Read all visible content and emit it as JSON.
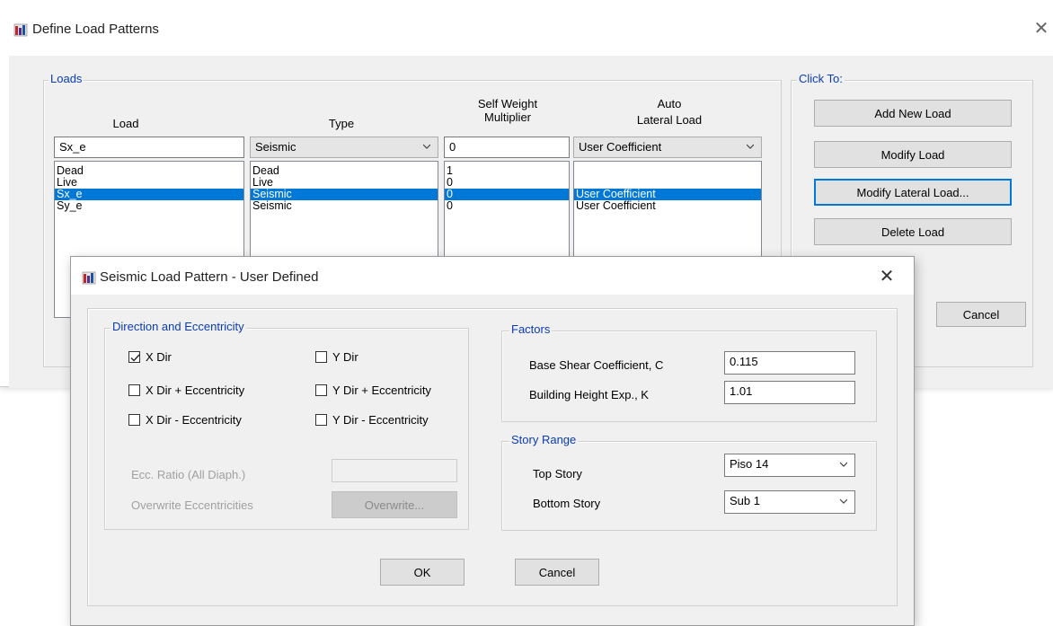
{
  "main_dialog": {
    "title": "Define Load Patterns",
    "loads_group_label": "Loads",
    "click_to_label": "Click To:",
    "headers": {
      "load": "Load",
      "type": "Type",
      "self_weight_line1": "Self Weight",
      "self_weight_line2": "Multiplier",
      "auto_line1": "Auto",
      "auto_line2": "Lateral Load"
    },
    "edit_row": {
      "load": "Sx_e",
      "type": "Seismic",
      "multiplier": "0",
      "auto_lateral": "User Coefficient"
    },
    "rows": [
      {
        "load": "Dead",
        "type": "Dead",
        "multiplier": "1",
        "auto_lateral": ""
      },
      {
        "load": "Live",
        "type": "Live",
        "multiplier": "0",
        "auto_lateral": ""
      },
      {
        "load": "Sx_e",
        "type": "Seismic",
        "multiplier": "0",
        "auto_lateral": "User Coefficient"
      },
      {
        "load": "Sy_e",
        "type": "Seismic",
        "multiplier": "0",
        "auto_lateral": "User Coefficient"
      }
    ],
    "buttons": {
      "add": "Add New Load",
      "modify": "Modify Load",
      "modify_lateral": "Modify Lateral Load...",
      "delete": "Delete Load",
      "cancel": "Cancel"
    }
  },
  "seismic_dialog": {
    "title": "Seismic Load Pattern - User Defined",
    "direction_group": "Direction and Eccentricity",
    "directions": [
      {
        "label": "X Dir",
        "checked": true
      },
      {
        "label": "X Dir + Eccentricity",
        "checked": false
      },
      {
        "label": "X Dir - Eccentricity",
        "checked": false
      },
      {
        "label": "Y Dir",
        "checked": false
      },
      {
        "label": "Y Dir + Eccentricity",
        "checked": false
      },
      {
        "label": "Y Dir - Eccentricity",
        "checked": false
      }
    ],
    "ecc_ratio_label": "Ecc. Ratio (All Diaph.)",
    "ecc_ratio_value": "",
    "overwrite_label": "Overwrite Eccentricities",
    "overwrite_button": "Overwrite...",
    "factors_group": "Factors",
    "base_shear_label": "Base Shear Coefficient, C",
    "base_shear_value": "0.115",
    "height_exp_label": "Building Height Exp., K",
    "height_exp_value": "1.01",
    "story_range_group": "Story Range",
    "top_story_label": "Top Story",
    "top_story_value": "Piso 14",
    "bottom_story_label": "Bottom Story",
    "bottom_story_value": "Sub 1",
    "ok_button": "OK",
    "cancel_button": "Cancel"
  },
  "colors": {
    "dialog_bg": "#f0f0f0",
    "selection": "#0078d7",
    "group_label": "#0a3cb4"
  }
}
